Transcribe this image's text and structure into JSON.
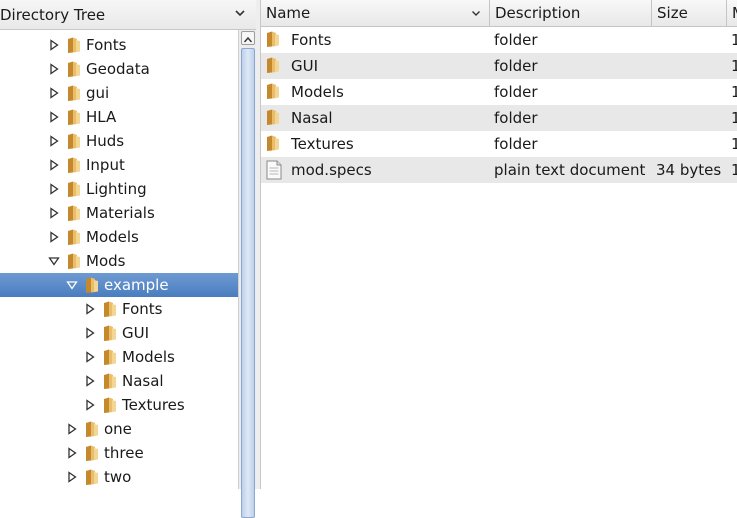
{
  "left_header": {
    "title": "Directory Tree"
  },
  "tree": [
    {
      "label": "Fonts",
      "depth": 0,
      "expanded": false,
      "selected": false
    },
    {
      "label": "Geodata",
      "depth": 0,
      "expanded": false,
      "selected": false
    },
    {
      "label": "gui",
      "depth": 0,
      "expanded": false,
      "selected": false
    },
    {
      "label": "HLA",
      "depth": 0,
      "expanded": false,
      "selected": false
    },
    {
      "label": "Huds",
      "depth": 0,
      "expanded": false,
      "selected": false
    },
    {
      "label": "Input",
      "depth": 0,
      "expanded": false,
      "selected": false
    },
    {
      "label": "Lighting",
      "depth": 0,
      "expanded": false,
      "selected": false
    },
    {
      "label": "Materials",
      "depth": 0,
      "expanded": false,
      "selected": false
    },
    {
      "label": "Models",
      "depth": 0,
      "expanded": false,
      "selected": false
    },
    {
      "label": "Mods",
      "depth": 0,
      "expanded": true,
      "selected": false
    },
    {
      "label": "example",
      "depth": 1,
      "expanded": true,
      "selected": true
    },
    {
      "label": "Fonts",
      "depth": 2,
      "expanded": false,
      "selected": false
    },
    {
      "label": "GUI",
      "depth": 2,
      "expanded": false,
      "selected": false
    },
    {
      "label": "Models",
      "depth": 2,
      "expanded": false,
      "selected": false
    },
    {
      "label": "Nasal",
      "depth": 2,
      "expanded": false,
      "selected": false
    },
    {
      "label": "Textures",
      "depth": 2,
      "expanded": false,
      "selected": false
    },
    {
      "label": "one",
      "depth": 1,
      "expanded": false,
      "selected": false
    },
    {
      "label": "three",
      "depth": 1,
      "expanded": false,
      "selected": false
    },
    {
      "label": "two",
      "depth": 1,
      "expanded": false,
      "selected": false
    }
  ],
  "columns": [
    {
      "key": "name",
      "label": "Name"
    },
    {
      "key": "description",
      "label": "Description"
    },
    {
      "key": "size",
      "label": "Size"
    },
    {
      "key": "modified",
      "label": "M"
    }
  ],
  "files": [
    {
      "icon": "folder-icon",
      "name": "Fonts",
      "description": "folder",
      "size": "",
      "modified": "1"
    },
    {
      "icon": "folder-icon",
      "name": "GUI",
      "description": "folder",
      "size": "",
      "modified": "1"
    },
    {
      "icon": "folder-icon",
      "name": "Models",
      "description": "folder",
      "size": "",
      "modified": "1"
    },
    {
      "icon": "folder-icon",
      "name": "Nasal",
      "description": "folder",
      "size": "",
      "modified": "1"
    },
    {
      "icon": "folder-icon",
      "name": "Textures",
      "description": "folder",
      "size": "",
      "modified": "1"
    },
    {
      "icon": "document-icon",
      "name": "mod.specs",
      "description": "plain text document",
      "size": "34 bytes",
      "modified": "1"
    }
  ],
  "colors": {
    "selection": "#4f82c4",
    "alt_row": "#e8e8e8",
    "folder": "#d9a441"
  }
}
